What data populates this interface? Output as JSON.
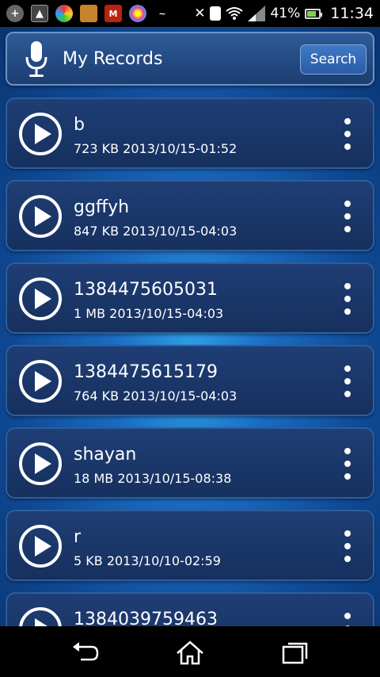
{
  "status_bar": {
    "battery": "41%",
    "time": "11:34",
    "icons": [
      "add-icon",
      "image-icon",
      "pinwheel-icon",
      "game-icon",
      "shield-app-icon",
      "flower-icon",
      "handwriting-app-icon",
      "bluetooth-off-icon",
      "sim-icon",
      "wifi-icon",
      "signal-icon"
    ]
  },
  "header": {
    "title": "My Records",
    "search_label": "Search",
    "icon": "microphone-icon"
  },
  "records": [
    {
      "name": "b",
      "meta": "723 KB 2013/10/15-01:52"
    },
    {
      "name": "ggffyh",
      "meta": "847 KB 2013/10/15-04:03"
    },
    {
      "name": "1384475605031",
      "meta": "1 MB 2013/10/15-04:03"
    },
    {
      "name": "1384475615179",
      "meta": "764 KB 2013/10/15-04:03"
    },
    {
      "name": "shayan",
      "meta": "18 MB 2013/10/15-08:38"
    },
    {
      "name": "r",
      "meta": "5 KB 2013/10/10-02:59"
    },
    {
      "name": "1384039759463",
      "meta": ""
    }
  ],
  "nav": [
    "back-icon",
    "home-icon",
    "recent-apps-icon"
  ]
}
